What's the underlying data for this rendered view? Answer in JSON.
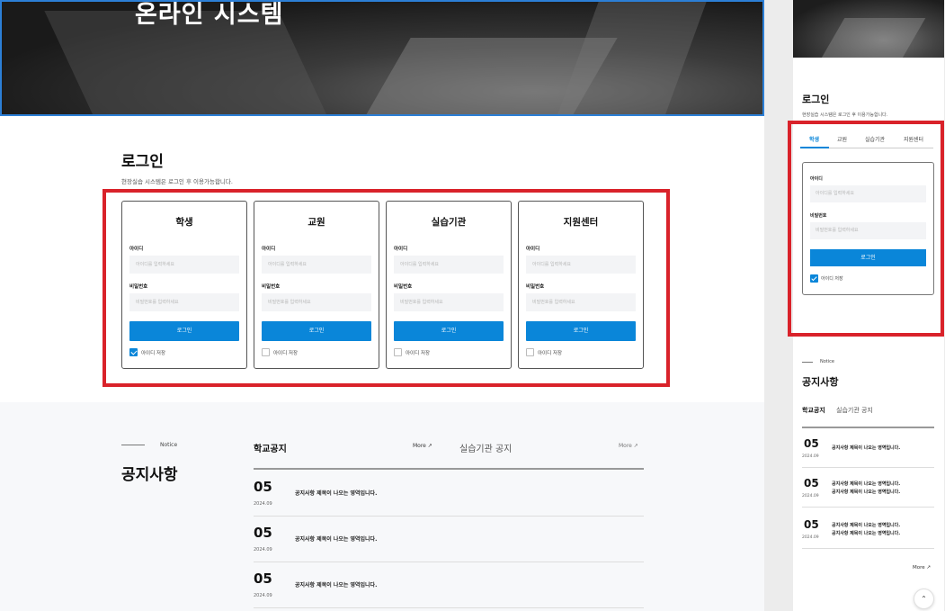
{
  "hero": {
    "title": "온라인 시스템"
  },
  "login": {
    "title": "로그인",
    "subtitle": "현장실습 시스템은 로그인 후 이용가능합니다.",
    "cards": [
      {
        "title": "학생",
        "id_label": "아이디",
        "id_placeholder": "아이디를 입력하세요",
        "pw_label": "비밀번호",
        "pw_placeholder": "비밀번호를 입력하세요",
        "button": "로그인",
        "remember": "아이디 저장",
        "checked": true
      },
      {
        "title": "교원",
        "id_label": "아이디",
        "id_placeholder": "아이디를 입력하세요",
        "pw_label": "비밀번호",
        "pw_placeholder": "비밀번호를 입력하세요",
        "button": "로그인",
        "remember": "아이디 저장",
        "checked": false
      },
      {
        "title": "실습기관",
        "id_label": "아이디",
        "id_placeholder": "아이디를 입력하세요",
        "pw_label": "비밀번호",
        "pw_placeholder": "비밀번호를 입력하세요",
        "button": "로그인",
        "remember": "아이디 저장",
        "checked": false
      },
      {
        "title": "지원센터",
        "id_label": "아이디",
        "id_placeholder": "아이디를 입력하세요",
        "pw_label": "비밀번호",
        "pw_placeholder": "비밀번호를 입력하세요",
        "button": "로그인",
        "remember": "아이디 저장",
        "checked": false
      }
    ]
  },
  "notice": {
    "eng": "Notice",
    "title": "공지사항",
    "tab1": "학교공지",
    "tab2": "실습기관 공지",
    "more": "More ↗",
    "rows": [
      {
        "day": "05",
        "date": "2024.09",
        "text": "공지사항 제목이 나오는 영역입니다."
      },
      {
        "day": "05",
        "date": "2024.09",
        "text": "공지사항 제목이 나오는 영역입니다."
      },
      {
        "day": "05",
        "date": "2024.09",
        "text": "공지사항 제목이 나오는 영역입니다."
      }
    ]
  },
  "mobile": {
    "login_title": "로그인",
    "login_subtitle": "현장실습 시스템은 로그인 후 이용가능합니다.",
    "tabs": [
      "학생",
      "교원",
      "실습기관",
      "지원센터"
    ],
    "id_label": "아이디",
    "id_placeholder": "아이디를 입력하세요",
    "pw_label": "비밀번호",
    "pw_placeholder": "비밀번호를 입력하세요",
    "button": "로그인",
    "remember": "아이디 저장",
    "notice_eng": "Notice",
    "notice_title": "공지사항",
    "notice_tab1": "학교공지",
    "notice_tab2": "실습기관 공지",
    "rows": [
      {
        "day": "05",
        "date": "2024.09",
        "line1": "공지사항 제목이 나오는 영역입니다.",
        "line2": ""
      },
      {
        "day": "05",
        "date": "2024.09",
        "line1": "공지사항 제목이 나오는 영역입니다.",
        "line2": "공지사항 제목이 나오는 영역입니다."
      },
      {
        "day": "05",
        "date": "2024.09",
        "line1": "공지사항 제목이 나오는 영역입니다.",
        "line2": "공지사항 제목이 나오는 영역입니다."
      }
    ],
    "more": "More ↗",
    "top_icon": "chevron-up-icon"
  },
  "colors": {
    "accent": "#0a86d9",
    "highlight": "#d9222a"
  }
}
